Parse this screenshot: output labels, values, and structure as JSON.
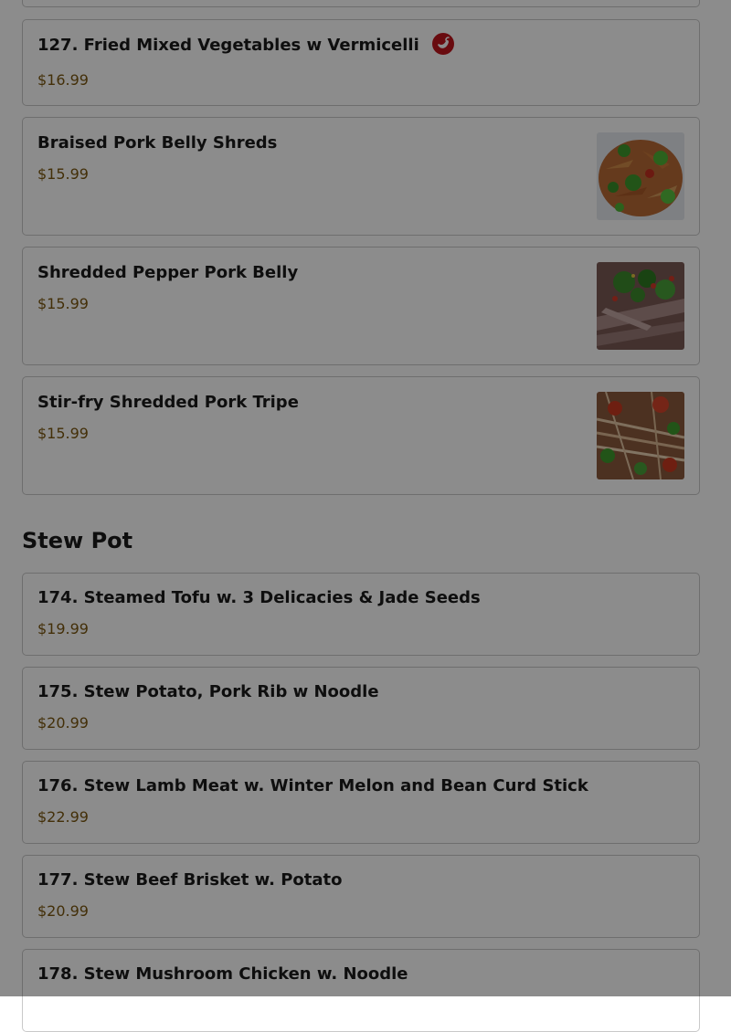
{
  "items_top": [
    {
      "name": "127. Fried Mixed Vegetables w Vermicelli",
      "price": "$16.99",
      "icon": "chili-pepper-icon"
    },
    {
      "name": "Braised Pork Belly Shreds",
      "price": "$15.99",
      "image": "braised-pork-belly-photo"
    },
    {
      "name": "Shredded Pepper Pork Belly",
      "price": "$15.99",
      "image": "shredded-pepper-pork-photo"
    },
    {
      "name": "Stir-fry Shredded Pork Tripe",
      "price": "$15.99",
      "image": "pork-tripe-photo"
    }
  ],
  "stew_section": {
    "title": "Stew Pot",
    "items": [
      {
        "name": "174. Steamed Tofu w. 3 Delicacies & Jade Seeds",
        "price": "$19.99"
      },
      {
        "name": "175. Stew Potato, Pork Rib w Noodle",
        "price": "$20.99"
      },
      {
        "name": "176. Stew Lamb Meat w. Winter Melon and Bean Curd Stick",
        "price": "$22.99"
      },
      {
        "name": "177. Stew Beef Brisket w. Potato",
        "price": "$20.99"
      },
      {
        "name": "178. Stew Mushroom Chicken w. Noodle",
        "price": ""
      }
    ]
  },
  "colors": {
    "price": "#7a5710",
    "spicy": "#c0141c",
    "overlay": "rgba(0,0,0,0.45)"
  }
}
